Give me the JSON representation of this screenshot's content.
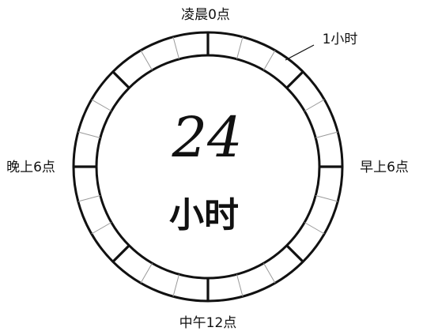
{
  "diagram": {
    "center_number": "24",
    "center_unit": "小时",
    "label_top": "凌晨0点",
    "label_right": "早上6点",
    "label_bottom": "中午12点",
    "label_left": "晚上6点",
    "label_callout": "1小时",
    "hour_segments": 24,
    "major_division_every": 3,
    "colors": {
      "ink": "#111111",
      "minor_tick": "#9a9a9a",
      "background": "#ffffff"
    }
  }
}
